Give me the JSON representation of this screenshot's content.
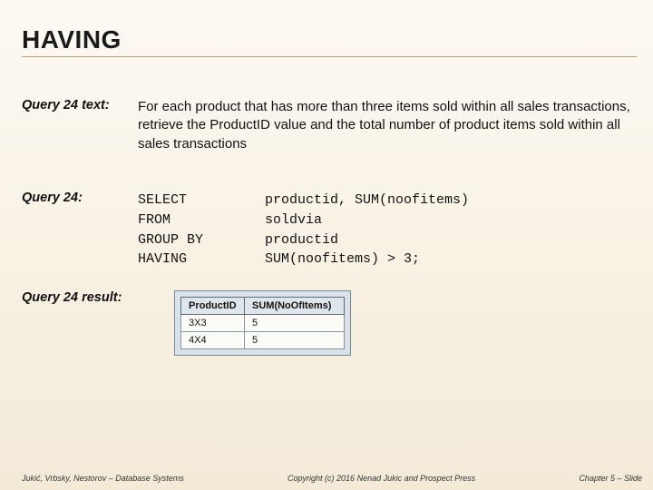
{
  "title": "HAVING",
  "labels": {
    "query_text": "Query 24 text:",
    "query": "Query 24:",
    "result": "Query 24 result:"
  },
  "body_text": "For each product that has more than three items sold within all sales transactions, retrieve the ProductID value and the total number of product items sold within all sales transactions",
  "sql": {
    "kw0": "SELECT",
    "kw1": "FROM",
    "kw2": "GROUP BY",
    "kw3": "HAVING",
    "arg0": "productid, SUM(noofitems)",
    "arg1": "soldvia",
    "arg2": "productid",
    "arg3": "SUM(noofitems) > 3;"
  },
  "result_table": {
    "headers": [
      "ProductID",
      "SUM(NoOfItems)"
    ],
    "rows": [
      [
        "3X3",
        "5"
      ],
      [
        "4X4",
        "5"
      ]
    ]
  },
  "footer": {
    "left": "Jukić, Vrbsky, Nestorov – Database Systems",
    "center": "Copyright (c) 2016 Nenad Jukic and Prospect Press",
    "right": "Chapter 5 – Slide"
  }
}
